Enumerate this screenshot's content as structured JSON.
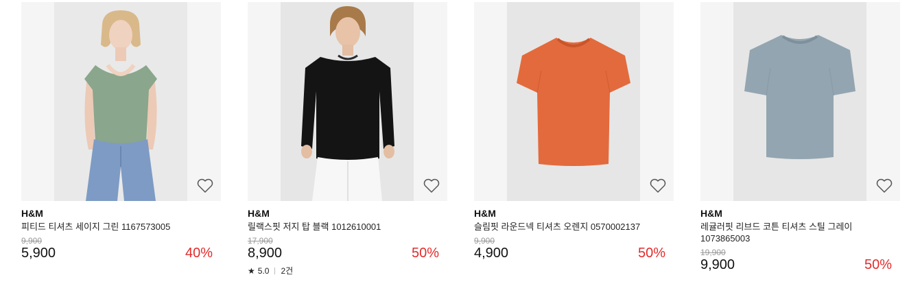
{
  "products": [
    {
      "brand": "H&M",
      "name": "피티드 티셔츠 세이지 그린 1167573005",
      "original_price": "9,900",
      "price": "5,900",
      "discount": "40%",
      "image": "woman-sage-green-tshirt",
      "shirt_color": "#8aa68c"
    },
    {
      "brand": "H&M",
      "name": "릴랙스핏 저지 탑 블랙 1012610001",
      "original_price": "17,900",
      "price": "8,900",
      "discount": "50%",
      "rating": {
        "star": "★",
        "score": "5.0",
        "count": "2건"
      },
      "image": "man-black-longsleeve",
      "shirt_color": "#141414"
    },
    {
      "brand": "H&M",
      "name": "슬림핏 라운드넥 티셔츠 오렌지 0570002137",
      "original_price": "9,900",
      "price": "4,900",
      "discount": "50%",
      "image": "orange-tshirt",
      "shirt_color": "#e36a3c"
    },
    {
      "brand": "H&M",
      "name": "레귤러핏 리브드 코튼 티셔츠 스틸 그레이 1073865003",
      "original_price": "19,900",
      "price": "9,900",
      "discount": "50%",
      "image": "steel-grey-tshirt",
      "shirt_color": "#93a5b0"
    }
  ],
  "colors": {
    "discount": "#e32b2b",
    "original_price": "#999999"
  },
  "icons": {
    "wishlist": "heart-outline-icon",
    "rating": "star-icon"
  }
}
